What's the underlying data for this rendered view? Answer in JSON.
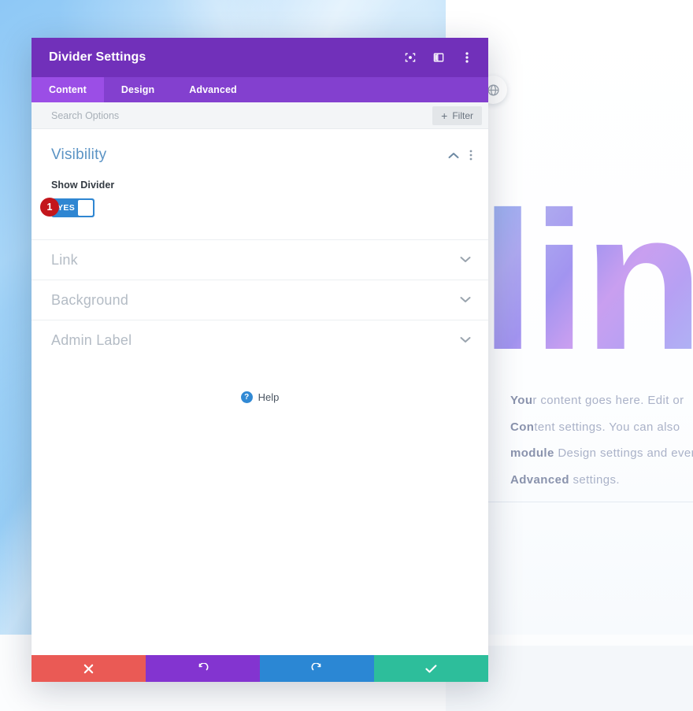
{
  "window": {
    "title": "Divider Settings",
    "header_icons": [
      {
        "name": "focus-icon",
        "label": "Focus"
      },
      {
        "name": "layout-toggle-icon",
        "label": "Layout"
      },
      {
        "name": "more-options-icon",
        "label": "More Options"
      }
    ]
  },
  "tabs": [
    {
      "label": "Content",
      "active": true
    },
    {
      "label": "Design",
      "active": false
    },
    {
      "label": "Advanced",
      "active": false
    }
  ],
  "search": {
    "placeholder": "Search Options",
    "value": "",
    "filter_label": "Filter",
    "filter_plus": "+"
  },
  "groups": {
    "open": {
      "title": "Visibility",
      "collapse_icon": "chevron-up-icon",
      "menu_icon": "group-more-icon",
      "fields": [
        {
          "label": "Show Divider",
          "type": "toggle",
          "value": "YES",
          "step_badge": "1"
        }
      ]
    },
    "collapsed": [
      {
        "title": "Link",
        "chevron": "chevron-down-icon"
      },
      {
        "title": "Background",
        "chevron": "chevron-down-icon"
      },
      {
        "title": "Admin Label",
        "chevron": "chevron-down-icon"
      }
    ]
  },
  "help": {
    "icon_glyph": "?",
    "label": "Help"
  },
  "footer_buttons": [
    {
      "name": "cancel-button",
      "icon": "close-icon",
      "color": "#ea5a55"
    },
    {
      "name": "undo-button",
      "icon": "undo-icon",
      "color": "#8334d0"
    },
    {
      "name": "redo-button",
      "icon": "redo-icon",
      "color": "#2b87d4"
    },
    {
      "name": "save-button",
      "icon": "check-icon",
      "color": "#2dbe9b"
    }
  ],
  "page_background": {
    "hero_letters": "lin",
    "globe_icon": "globe-icon",
    "body_lines": [
      {
        "strong": "You",
        "rest": "r content goes here. Edit or"
      },
      {
        "strong": "Con",
        "rest": "tent settings. You can also"
      },
      {
        "strong": "module",
        "rest": " Design settings and even"
      },
      {
        "strong": "Advanced",
        "rest": " settings."
      }
    ]
  },
  "colors": {
    "header_purple": "#7130ba",
    "tabbar_purple": "#8340cf",
    "tab_active_purple": "#9b4ee6",
    "toggle_blue": "#2f86d2",
    "badge_red": "#c3161c",
    "group_title_blue": "#5a93c4"
  }
}
